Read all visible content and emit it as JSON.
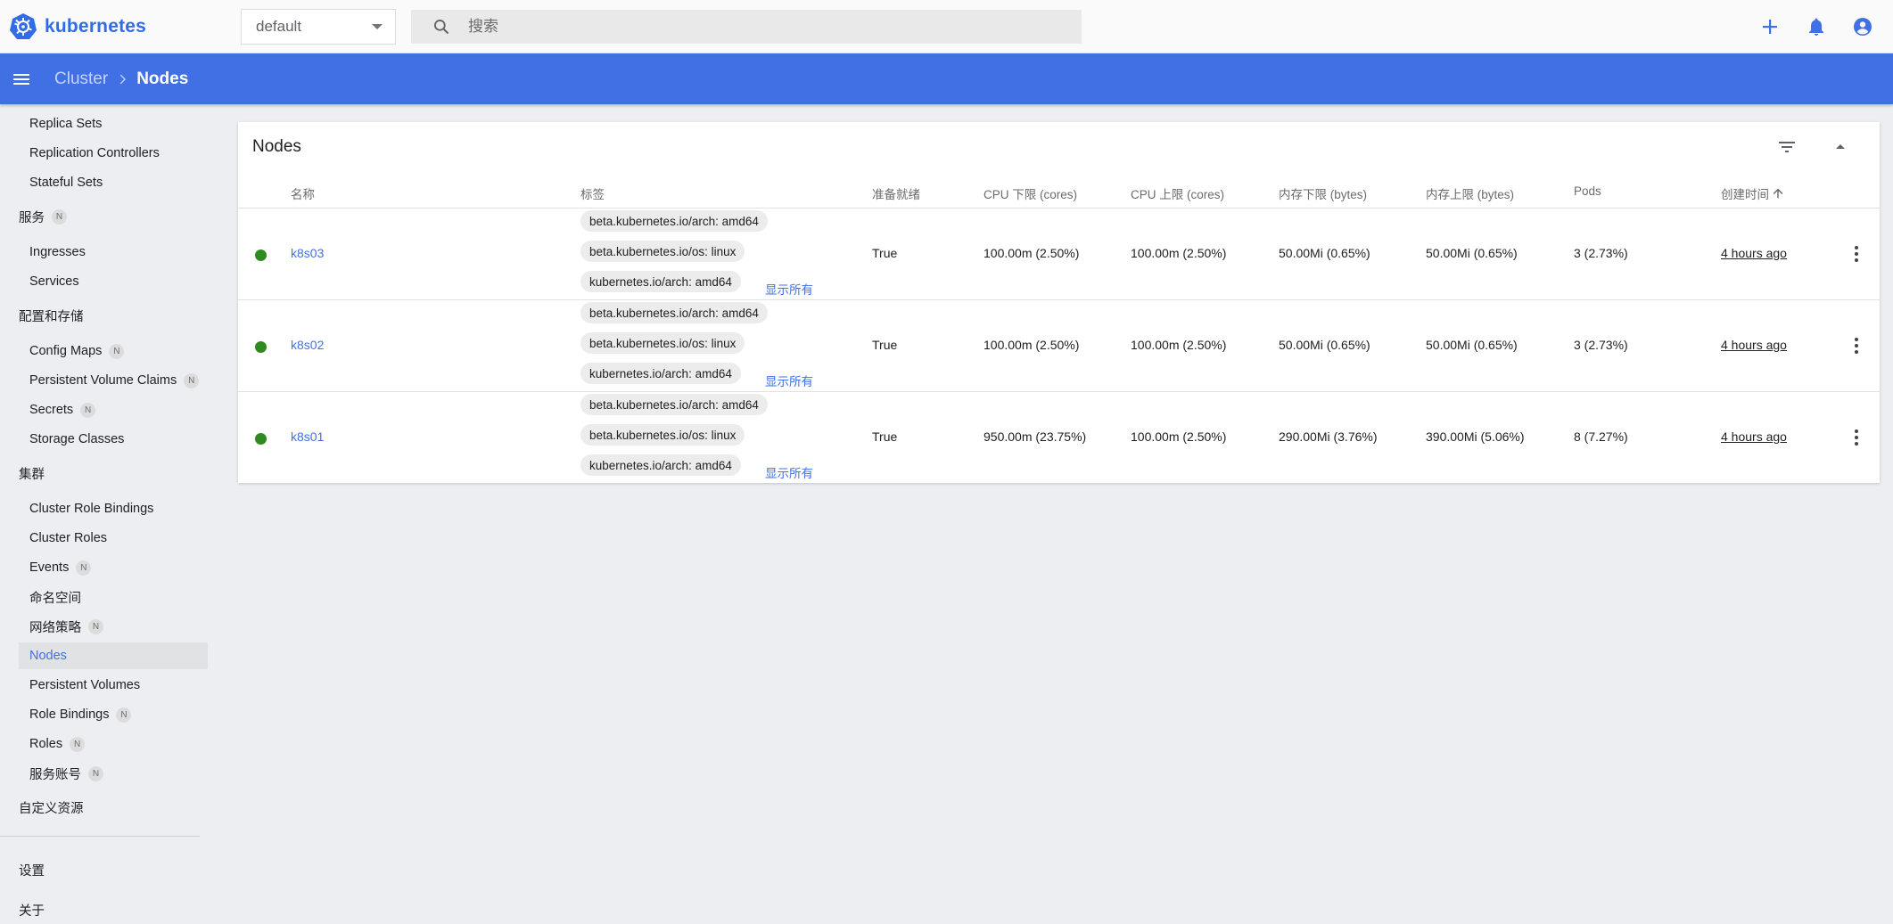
{
  "app": {
    "brand": "kubernetes",
    "namespace": "default",
    "search_placeholder": "搜索",
    "icons": [
      "kubernetes-logo-icon",
      "chevron-down-icon",
      "search-icon",
      "plus-icon",
      "bell-icon",
      "account-circle-icon"
    ]
  },
  "breadcrumb": {
    "parent": "Cluster",
    "current": "Nodes"
  },
  "sidebar": {
    "items_top": [
      "Replica Sets",
      "Replication Controllers",
      "Stateful Sets"
    ],
    "section_service": "服务",
    "service_items": [
      "Ingresses",
      "Services"
    ],
    "section_config": "配置和存储",
    "config_items": [
      "Config Maps",
      "Persistent Volume Claims",
      "Secrets",
      "Storage Classes"
    ],
    "section_cluster": "集群",
    "cluster_items": [
      "Cluster Role Bindings",
      "Cluster Roles",
      "Events",
      "命名空间",
      "网络策略",
      "Nodes",
      "Persistent Volumes",
      "Role Bindings",
      "Roles",
      "服务账号"
    ],
    "section_crd": "自定义资源",
    "settings": "设置",
    "about": "关于",
    "badge": "N",
    "active_item": "Nodes"
  },
  "card": {
    "title": "Nodes",
    "columns": [
      "名称",
      "标签",
      "准备就绪",
      "CPU 下限 (cores)",
      "CPU 上限 (cores)",
      "内存下限 (bytes)",
      "内存上限 (bytes)",
      "Pods",
      "创建时间"
    ],
    "sorted_column": "创建时间",
    "show_all_label": "显示所有",
    "rows": [
      {
        "name": "k8s03",
        "labels": [
          "beta.kubernetes.io/arch: amd64",
          "beta.kubernetes.io/os: linux",
          "kubernetes.io/arch: amd64"
        ],
        "ready": "True",
        "cpu_requests": "100.00m (2.50%)",
        "cpu_limits": "100.00m (2.50%)",
        "mem_requests": "50.00Mi (0.65%)",
        "mem_limits": "50.00Mi (0.65%)",
        "pods": "3 (2.73%)",
        "age": "4 hours ago",
        "status_color": "#2e8b1f"
      },
      {
        "name": "k8s02",
        "labels": [
          "beta.kubernetes.io/arch: amd64",
          "beta.kubernetes.io/os: linux",
          "kubernetes.io/arch: amd64"
        ],
        "ready": "True",
        "cpu_requests": "100.00m (2.50%)",
        "cpu_limits": "100.00m (2.50%)",
        "mem_requests": "50.00Mi (0.65%)",
        "mem_limits": "50.00Mi (0.65%)",
        "pods": "3 (2.73%)",
        "age": "4 hours ago",
        "status_color": "#2e8b1f"
      },
      {
        "name": "k8s01",
        "labels": [
          "beta.kubernetes.io/arch: amd64",
          "beta.kubernetes.io/os: linux",
          "kubernetes.io/arch: amd64"
        ],
        "ready": "True",
        "cpu_requests": "950.00m (23.75%)",
        "cpu_limits": "100.00m (2.50%)",
        "mem_requests": "290.00Mi (3.76%)",
        "mem_limits": "390.00Mi (5.06%)",
        "pods": "8 (7.27%)",
        "age": "4 hours ago",
        "status_color": "#2e8b1f"
      }
    ]
  },
  "colors": {
    "accent": "#4070e4",
    "brand": "#326ce5",
    "ready": "#2e8b1f"
  }
}
